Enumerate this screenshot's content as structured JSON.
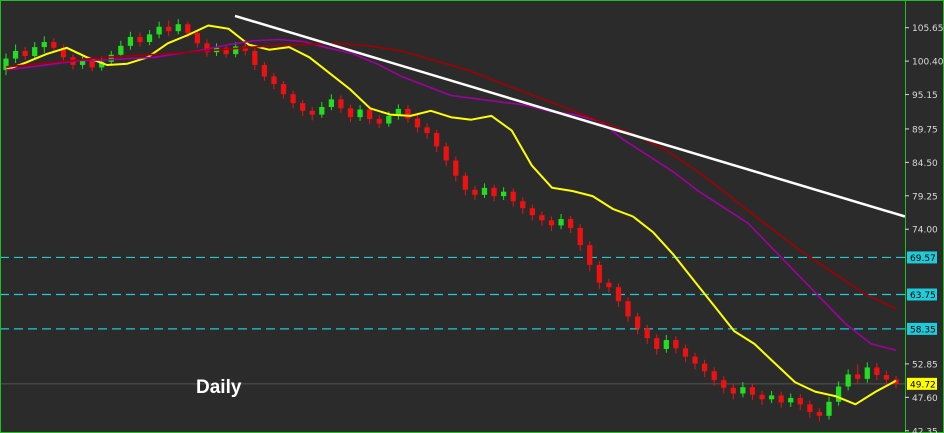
{
  "chart_data": {
    "type": "candlestick",
    "timeframe_label": "Daily",
    "y_axis": {
      "ticks": [
        105.65,
        100.4,
        95.15,
        89.75,
        84.5,
        79.25,
        74.0,
        68.75,
        58.35,
        52.85,
        47.6,
        42.35
      ],
      "range": [
        42.0,
        110.0
      ],
      "position": "right"
    },
    "grid": false,
    "legend": "none",
    "current_price": 49.72,
    "horizontal_levels": [
      69.57,
      63.75,
      58.35
    ],
    "indicators": [
      {
        "type": "moving_average",
        "color": "#ffff00",
        "values": [
          99.0,
          100.2,
          101.5,
          102.5,
          101.0,
          99.8,
          100.0,
          101.0,
          103.2,
          104.5,
          106.0,
          105.5,
          103.0,
          102.2,
          102.6,
          101.0,
          98.5,
          96.0,
          93.0,
          92.0,
          91.8,
          92.6,
          91.6,
          91.2,
          91.8,
          89.5,
          84.0,
          80.5,
          80.0,
          79.2,
          77.2,
          76.0,
          73.5,
          70.0,
          66.0,
          62.0,
          58.0,
          56.0,
          53.0,
          50.0,
          48.5,
          47.8,
          46.5,
          48.5,
          50.2
        ]
      },
      {
        "type": "moving_average",
        "color": "#a000a0",
        "values": [
          99.0,
          99.5,
          100.0,
          100.5,
          100.6,
          100.8,
          101.0,
          101.6,
          102.2,
          103.0,
          103.6,
          103.8,
          103.5,
          102.5,
          101.6,
          100.0,
          98.0,
          96.5,
          95.0,
          94.5,
          94.0,
          93.5,
          92.5,
          92.0,
          91.0,
          88.0,
          85.5,
          83.0,
          80.0,
          77.5,
          75.0,
          71.0,
          67.0,
          63.0,
          59.0,
          56.0,
          55.0
        ]
      },
      {
        "type": "moving_average",
        "color": "#a00000",
        "values": [
          99.5,
          100.0,
          100.5,
          101.0,
          101.3,
          101.6,
          102.0,
          102.4,
          102.8,
          103.0,
          103.2,
          102.8,
          102.0,
          100.5,
          99.0,
          97.0,
          95.0,
          93.0,
          91.0,
          89.0,
          86.5,
          83.0,
          79.0,
          75.0,
          71.0,
          67.5,
          64.0,
          61.5
        ]
      }
    ],
    "trendline": {
      "start": 107.5,
      "end": 76.0,
      "color": "#ffffff"
    },
    "candles": [
      [
        99.0,
        100.8,
        98.2,
        101.6
      ],
      [
        100.8,
        102.0,
        100.1,
        103.0
      ],
      [
        102.0,
        101.2,
        100.6,
        102.6
      ],
      [
        101.2,
        102.6,
        100.9,
        103.4
      ],
      [
        102.6,
        103.4,
        101.7,
        104.3
      ],
      [
        103.4,
        102.5,
        101.9,
        104.0
      ],
      [
        102.5,
        101.0,
        100.2,
        103.0
      ],
      [
        101.0,
        99.8,
        99.1,
        101.5
      ],
      [
        99.8,
        100.5,
        99.2,
        101.2
      ],
      [
        100.5,
        99.4,
        98.8,
        101.0
      ],
      [
        99.4,
        100.3,
        98.9,
        101.1
      ],
      [
        100.3,
        101.4,
        99.9,
        102.0
      ],
      [
        101.4,
        102.8,
        101.0,
        103.6
      ],
      [
        102.8,
        104.2,
        102.2,
        105.0
      ],
      [
        104.2,
        103.4,
        102.7,
        104.9
      ],
      [
        103.4,
        104.6,
        102.9,
        105.3
      ],
      [
        104.6,
        105.8,
        104.0,
        106.6
      ],
      [
        105.8,
        105.1,
        104.3,
        106.8
      ],
      [
        105.1,
        106.2,
        104.6,
        107.0
      ],
      [
        106.2,
        104.8,
        104.1,
        106.6
      ],
      [
        104.8,
        103.2,
        102.5,
        105.3
      ],
      [
        103.2,
        101.8,
        101.1,
        103.8
      ],
      [
        101.8,
        102.5,
        101.2,
        103.2
      ],
      [
        102.5,
        101.5,
        100.9,
        103.0
      ],
      [
        101.5,
        102.7,
        101.0,
        103.4
      ],
      [
        102.7,
        102.0,
        101.3,
        103.3
      ],
      [
        102.0,
        99.8,
        99.0,
        102.4
      ],
      [
        99.8,
        98.0,
        97.3,
        100.3
      ],
      [
        98.0,
        96.8,
        96.0,
        98.5
      ],
      [
        96.8,
        95.2,
        94.5,
        97.3
      ],
      [
        95.2,
        93.8,
        93.0,
        95.8
      ],
      [
        93.8,
        92.6,
        91.8,
        94.3
      ],
      [
        92.6,
        92.0,
        91.1,
        93.2
      ],
      [
        92.0,
        93.2,
        91.5,
        94.0
      ],
      [
        93.2,
        94.4,
        92.7,
        95.2
      ],
      [
        94.4,
        93.0,
        92.3,
        95.0
      ],
      [
        93.0,
        91.6,
        90.8,
        93.6
      ],
      [
        91.6,
        92.8,
        91.0,
        93.5
      ],
      [
        92.8,
        91.3,
        90.5,
        93.4
      ],
      [
        91.3,
        90.6,
        89.9,
        91.9
      ],
      [
        90.6,
        91.8,
        90.1,
        92.5
      ],
      [
        91.8,
        92.9,
        91.2,
        93.6
      ],
      [
        92.9,
        91.4,
        90.7,
        93.5
      ],
      [
        91.4,
        90.0,
        89.2,
        92.0
      ],
      [
        90.0,
        89.1,
        88.2,
        90.6
      ],
      [
        89.1,
        87.0,
        86.1,
        89.6
      ],
      [
        87.0,
        84.8,
        83.9,
        87.6
      ],
      [
        84.8,
        82.4,
        81.5,
        85.4
      ],
      [
        82.4,
        80.2,
        79.3,
        82.9
      ],
      [
        80.2,
        79.4,
        78.6,
        80.8
      ],
      [
        79.4,
        80.5,
        78.9,
        81.2
      ],
      [
        80.5,
        79.2,
        78.4,
        81.0
      ],
      [
        79.2,
        79.9,
        78.6,
        80.6
      ],
      [
        79.9,
        78.4,
        77.6,
        80.4
      ],
      [
        78.4,
        77.3,
        76.4,
        79.0
      ],
      [
        77.3,
        76.2,
        75.4,
        77.9
      ],
      [
        76.2,
        75.4,
        74.5,
        76.8
      ],
      [
        75.4,
        74.6,
        73.7,
        76.0
      ],
      [
        74.6,
        75.6,
        74.0,
        76.4
      ],
      [
        75.6,
        74.2,
        73.4,
        76.1
      ],
      [
        74.2,
        71.5,
        70.6,
        74.8
      ],
      [
        71.5,
        68.4,
        67.4,
        72.1
      ],
      [
        68.4,
        65.6,
        64.6,
        69.0
      ],
      [
        65.6,
        64.9,
        64.0,
        66.2
      ],
      [
        64.9,
        62.7,
        61.8,
        65.5
      ],
      [
        62.7,
        60.3,
        59.4,
        63.3
      ],
      [
        60.3,
        58.4,
        57.5,
        60.9
      ],
      [
        58.4,
        56.9,
        56.0,
        59.0
      ],
      [
        56.9,
        55.2,
        54.3,
        57.5
      ],
      [
        55.2,
        56.6,
        54.6,
        57.4
      ],
      [
        56.6,
        55.3,
        54.5,
        57.2
      ],
      [
        55.3,
        54.0,
        53.1,
        55.9
      ],
      [
        54.0,
        52.9,
        52.0,
        54.6
      ],
      [
        52.9,
        51.7,
        50.8,
        53.5
      ],
      [
        51.7,
        50.3,
        49.4,
        52.3
      ],
      [
        50.3,
        49.1,
        48.2,
        50.9
      ],
      [
        49.1,
        48.2,
        47.3,
        49.7
      ],
      [
        48.2,
        49.2,
        47.6,
        50.0
      ],
      [
        49.2,
        48.0,
        47.2,
        49.8
      ],
      [
        48.0,
        47.3,
        46.4,
        48.6
      ],
      [
        47.3,
        47.9,
        46.7,
        48.6
      ],
      [
        47.9,
        46.8,
        46.0,
        48.5
      ],
      [
        46.8,
        47.5,
        46.1,
        48.2
      ],
      [
        47.5,
        46.5,
        45.6,
        48.1
      ],
      [
        46.5,
        45.3,
        44.4,
        47.1
      ],
      [
        45.3,
        44.7,
        43.8,
        45.9
      ],
      [
        44.7,
        46.9,
        44.1,
        47.7
      ],
      [
        46.9,
        49.3,
        46.3,
        50.1
      ],
      [
        49.3,
        51.2,
        48.7,
        52.0
      ],
      [
        51.2,
        50.5,
        49.7,
        52.8
      ],
      [
        50.5,
        52.3,
        49.9,
        53.1
      ],
      [
        52.3,
        51.1,
        50.3,
        53.0
      ],
      [
        51.1,
        50.4,
        49.6,
        51.8
      ],
      [
        50.4,
        49.72,
        49.0,
        51.0
      ]
    ]
  },
  "colors": {
    "background": "#2b2b2b",
    "bull": "#22dd22",
    "bear": "#ee1111",
    "level_line": "#1ecbd8",
    "level_label_bg": "#1ecbd8",
    "current_price_bg": "#ffff00",
    "axis_border": "#20c020",
    "current_line": "#555555"
  }
}
